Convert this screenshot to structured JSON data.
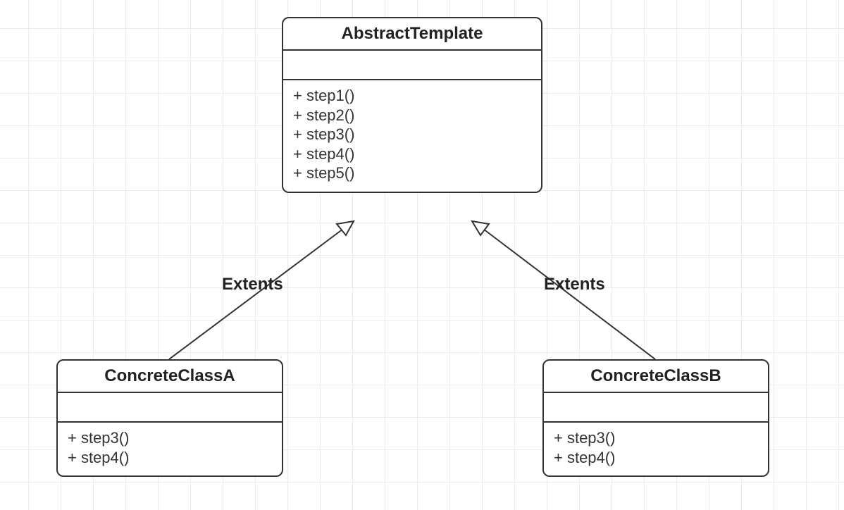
{
  "diagram": {
    "classes": {
      "abstract": {
        "name": "AbstractTemplate",
        "methods": [
          "+ step1()",
          "+ step2()",
          "+ step3()",
          "+ step4()",
          "+ step5()"
        ]
      },
      "concreteA": {
        "name": "ConcreteClassA",
        "methods": [
          "+ step3()",
          "+ step4()"
        ]
      },
      "concreteB": {
        "name": "ConcreteClassB",
        "methods": [
          "+ step3()",
          "+ step4()"
        ]
      }
    },
    "edges": {
      "left": {
        "label": "Extents"
      },
      "right": {
        "label": "Extents"
      }
    }
  }
}
